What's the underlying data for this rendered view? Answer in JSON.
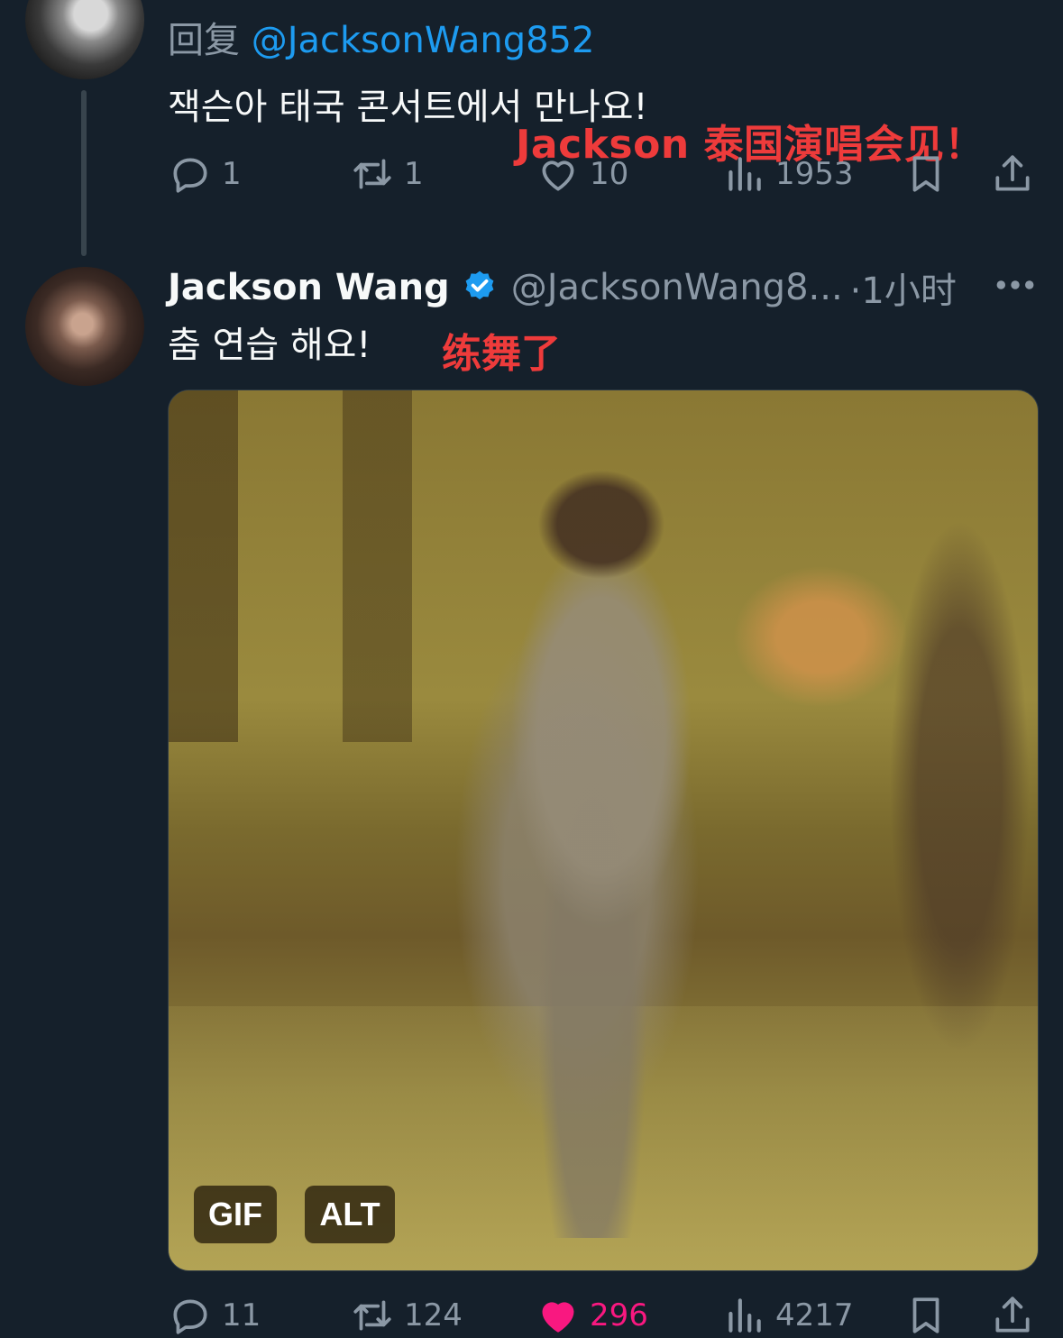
{
  "tweet1": {
    "reply_prefix": "回复",
    "reply_handle": "@JacksonWang852",
    "text": "잭슨아 태국 콘서트에서 만나요!",
    "overlay_caption": "Jackson 泰国演唱会见！",
    "stats": {
      "replies": "1",
      "retweets": "1",
      "likes": "10",
      "views": "1953"
    }
  },
  "tweet2": {
    "name": "Jackson Wang",
    "handle": "@JacksonWang8...",
    "time": "·1小时",
    "text": "춤 연습 해요!",
    "overlay_caption": "练舞了",
    "media": {
      "gif_badge": "GIF",
      "alt_badge": "ALT"
    },
    "stats": {
      "replies": "11",
      "retweets": "124",
      "likes": "296",
      "views": "4217"
    },
    "liked": true
  },
  "colors": {
    "background": "#15202b",
    "link": "#1d9bf0",
    "muted": "#8b98a5",
    "like_active": "#f91880",
    "overlay_red": "#ee3b3b"
  },
  "icons": [
    "reply-icon",
    "retweet-icon",
    "like-icon",
    "views-icon",
    "bookmark-icon",
    "share-icon",
    "verified-badge-icon",
    "more-icon"
  ]
}
